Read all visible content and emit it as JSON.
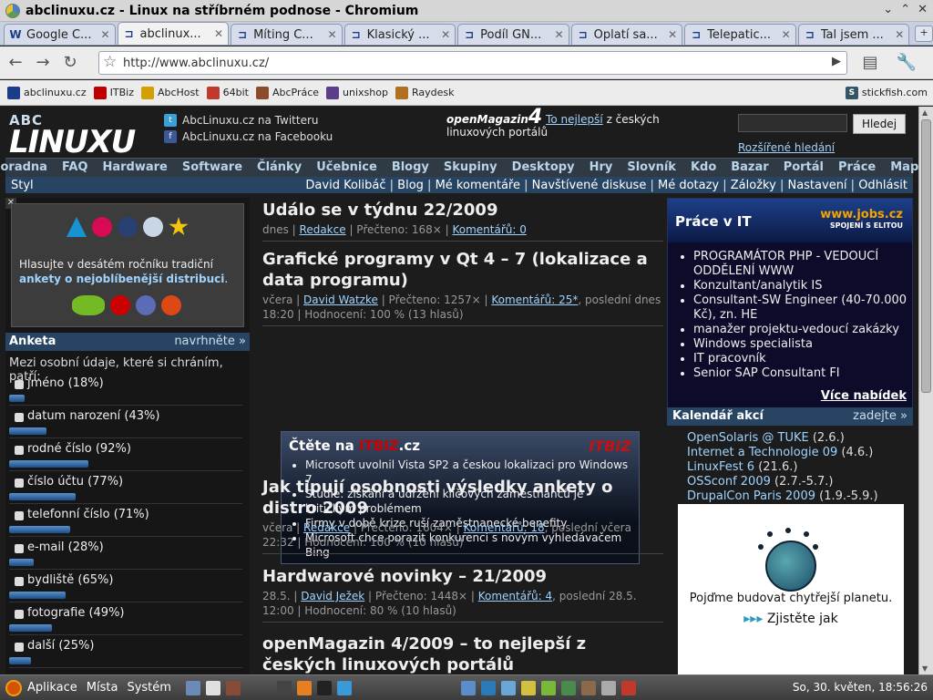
{
  "window": {
    "title": "abclinuxu.cz - Linux na stříbrném podnose - Chromium"
  },
  "tabs": [
    {
      "label": "Google C...",
      "icon": "google-icon"
    },
    {
      "label": "abclinux...",
      "icon": "abclinuxu-icon",
      "active": true
    },
    {
      "label": "Míting Č...",
      "icon": "abclinuxu-icon"
    },
    {
      "label": "Klasický ...",
      "icon": "abclinuxu-icon"
    },
    {
      "label": "Podíl GN...",
      "icon": "abclinuxu-icon"
    },
    {
      "label": "Oplatí sa...",
      "icon": "abclinuxu-icon"
    },
    {
      "label": "Telepatic...",
      "icon": "abclinuxu-icon"
    },
    {
      "label": "Tal jsem ...",
      "icon": "abclinuxu-icon"
    }
  ],
  "address": {
    "url": "http://www.abclinuxu.cz/"
  },
  "bookmarks": [
    {
      "label": "abclinuxu.cz",
      "color": "#1a3c8a"
    },
    {
      "label": "ITBiz",
      "color": "#c00000"
    },
    {
      "label": "AbcHost",
      "color": "#d4a000"
    },
    {
      "label": "64bit",
      "color": "#c0392b"
    },
    {
      "label": "AbcPráce",
      "color": "#8e4b2a"
    },
    {
      "label": "unixshop",
      "color": "#5b3d8a"
    },
    {
      "label": "Raydesk",
      "color": "#b07020"
    }
  ],
  "bookmark_right": "stickfish.com",
  "header": {
    "twitter": "AbcLinuxu.cz na Twitteru",
    "facebook": "AbcLinuxu.cz na Facebooku",
    "openmag_brand": "openMagazin",
    "openmag_num": "4",
    "openmag_link": "To nejlepší",
    "openmag_rest": "z českých linuxových portálů",
    "search_button": "Hledej",
    "search_advanced": "Rozšířené hledání"
  },
  "mainnav": [
    "Poradna",
    "FAQ",
    "Hardware",
    "Software",
    "Články",
    "Učebnice",
    "Blogy",
    "Skupiny",
    "Desktopy",
    "Hry",
    "Slovník",
    "Kdo je",
    "Bazar",
    "Portál",
    "Práce",
    "Mapa"
  ],
  "subnav": {
    "styl": "Styl",
    "links": [
      "David Kolibáč",
      "Blog",
      "Mé komentáře",
      "Navštívené diskuse",
      "Mé dotazy",
      "Záložky",
      "Nastavení",
      "Odhlásit"
    ]
  },
  "distro": {
    "text1": "Hlasujte v desátém ročníku tradiční ",
    "link": "ankety o nejoblíbenější distribuci",
    "text2": "."
  },
  "anketa": {
    "title": "Anketa",
    "nominate": "navrhněte »",
    "question": "Mezi osobní údaje, které si chráním, patří:",
    "items": [
      {
        "label": "jméno (18%)",
        "pct": 18
      },
      {
        "label": "datum narození (43%)",
        "pct": 43
      },
      {
        "label": "rodné číslo (92%)",
        "pct": 92
      },
      {
        "label": "číslo účtu (77%)",
        "pct": 77
      },
      {
        "label": "telefonní číslo (71%)",
        "pct": 71
      },
      {
        "label": "e-mail (28%)",
        "pct": 28
      },
      {
        "label": "bydliště (65%)",
        "pct": 65
      },
      {
        "label": "fotografie (49%)",
        "pct": 49
      },
      {
        "label": "další (25%)",
        "pct": 25
      }
    ]
  },
  "articles": [
    {
      "title": "Událo se v týdnu 22/2009",
      "meta_a": "dnes | ",
      "author": "Redakce",
      "meta_b": " | Přečteno: 168× | ",
      "comments": "Komentářů: 0",
      "meta_c": ""
    },
    {
      "title": "Grafické programy v Qt 4 – 7 (lokalizace a data programu)",
      "meta_a": "včera | ",
      "author": "David Watzke",
      "meta_b": " | Přečteno: 1257× | ",
      "comments": "Komentářů: 25*",
      "meta_c": ", poslední dnes 18:20 | Hodnocení: 100 % (13 hlasů)"
    },
    {
      "title": "Jak tipují osobnosti výsledky ankety o distro 2009",
      "meta_a": "včera | ",
      "author": "Redakce",
      "meta_b": " | Přečteno: 1604× | ",
      "comments": "Komentářů: 18",
      "meta_c": ", poslední včera 22:32 | Hodnocení: 100 % (10 hlasů)"
    },
    {
      "title": "Hardwarové novinky – 21/2009",
      "meta_a": "28.5. | ",
      "author": "David Ježek",
      "meta_b": " | Přečteno: 1448× | ",
      "comments": "Komentářů: 4",
      "meta_c": ", poslední 28.5. 12:00 | Hodnocení: 80 % (10 hlasů)"
    },
    {
      "title": "openMagazin 4/2009 – to nejlepší z českých linuxových portálů",
      "meta_a": "",
      "author": "",
      "meta_b": "",
      "comments": "",
      "meta_c": ""
    }
  ],
  "itbiz": {
    "heading_a": "Čtěte na ",
    "heading_b": "ITBIZ",
    ".cz": ".cz",
    "heading_c": ".cz",
    "logo": "ITBIZ",
    "items": [
      "Microsoft uvolnil Vista SP2 a českou lokalizaci pro Windows 7",
      "Studie: získání a udržení klíčových zaměstnanců je kritickým problémem",
      "Firmy v době krize ruší zaměstnanecké benefity",
      "Microsoft chce porazit konkurenci s novým vyhledávačem Bing"
    ]
  },
  "jobs": {
    "title": "Práce v IT",
    "brand": "www.jobs.cz",
    "brand_sub": "SPOJENÍ S ELITOU",
    "items": [
      "PROGRAMÁTOR PHP - VEDOUCÍ ODDĚLENÍ WWW",
      "Konzultant/analytik IS",
      "Consultant-SW Engineer (40-70.000 Kč), zn. HE",
      "manažer projektu-vedoucí zakázky",
      "Windows specialista",
      "IT pracovník",
      "Senior SAP Consultant FI"
    ],
    "more": "Více nabídek"
  },
  "calendar": {
    "title": "Kalendář akcí",
    "more": "zadejte »",
    "events": [
      {
        "name": "OpenSolaris @ TUKE",
        "date": " (2.6.)"
      },
      {
        "name": "Internet a Technologie 09",
        "date": " (4.6.)"
      },
      {
        "name": "LinuxFest 6",
        "date": " (21.6.)"
      },
      {
        "name": "OSSconf 2009",
        "date": " (2.7.-5.7.)"
      },
      {
        "name": "DrupalCon Paris 2009",
        "date": " (1.9.-5.9.)"
      }
    ]
  },
  "ibm": {
    "slogan": "Pojďme budovat chytřejší planetu.",
    "arrow": "▸▸▸",
    "cta": "Zjistěte jak"
  },
  "taskbar": {
    "apps": "Aplikace",
    "places": "Místa",
    "system": "Systém",
    "clock": "So, 30. květen, 18:56:26"
  }
}
